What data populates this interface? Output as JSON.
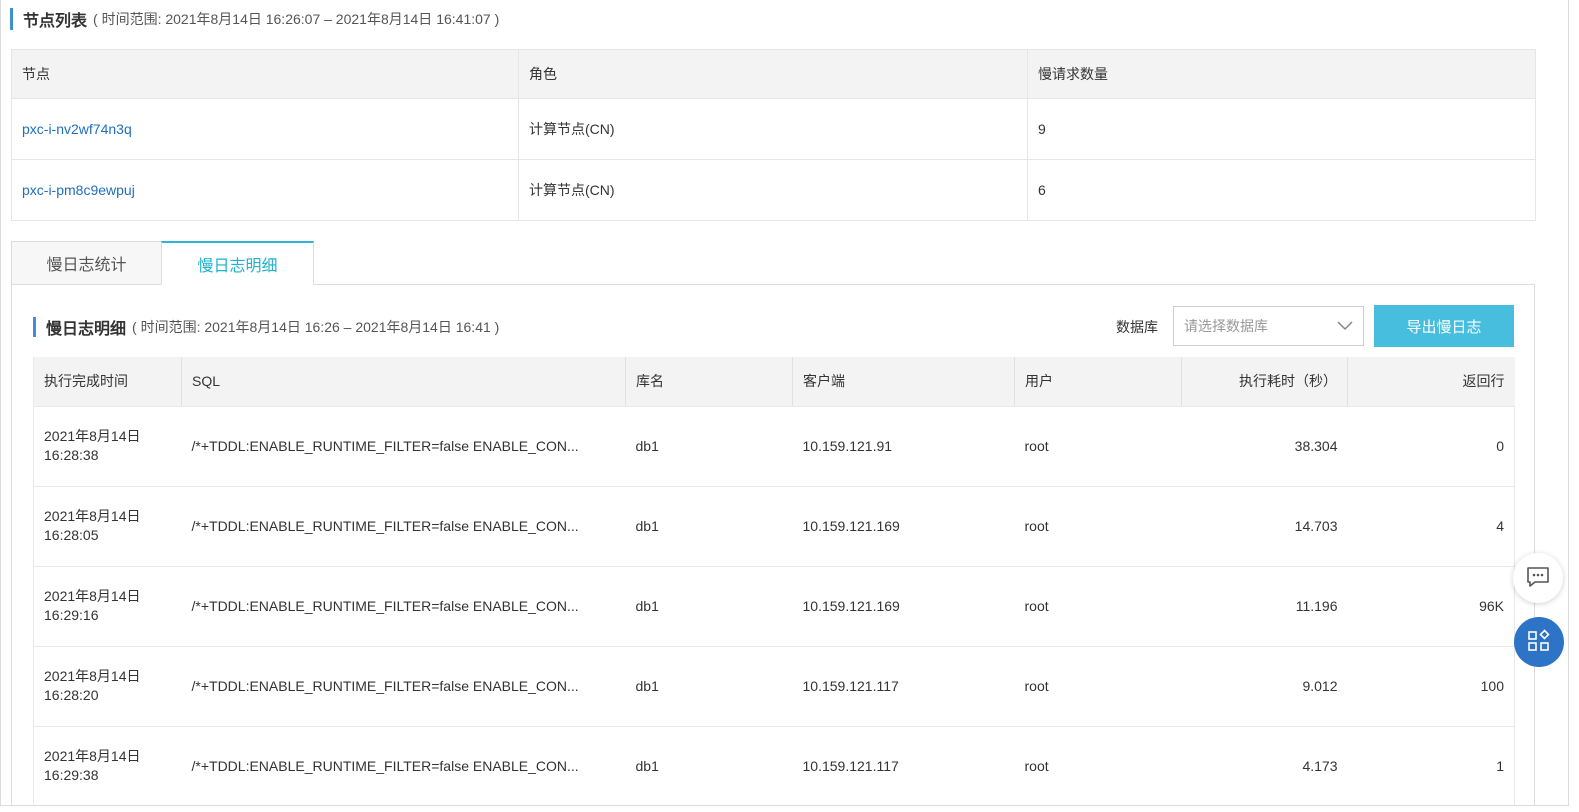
{
  "node_section": {
    "title": "节点列表",
    "range": "( 时间范围: 2021年8月14日 16:26:07 – 2021年8月14日 16:41:07 )",
    "columns": [
      "节点",
      "角色",
      "慢请求数量"
    ],
    "rows": [
      {
        "node": "pxc-i-nv2wf74n3q",
        "role": "计算节点(CN)",
        "count": "9"
      },
      {
        "node": "pxc-i-pm8c9ewpuj",
        "role": "计算节点(CN)",
        "count": "6"
      }
    ]
  },
  "tabs": [
    {
      "label": "慢日志统计",
      "active": false
    },
    {
      "label": "慢日志明细",
      "active": true
    }
  ],
  "detail_section": {
    "title": "慢日志明细",
    "range": "( 时间范围: 2021年8月14日 16:26 – 2021年8月14日 16:41 )",
    "db_label": "数据库",
    "db_placeholder": "请选择数据库",
    "export_label": "导出慢日志",
    "columns": [
      "执行完成时间",
      "SQL",
      "库名",
      "客户端",
      "用户",
      "执行耗时（秒）",
      "返回行"
    ],
    "rows": [
      {
        "date": "2021年8月14日",
        "time": "16:28:38",
        "sql": "/*+TDDL:ENABLE_RUNTIME_FILTER=false ENABLE_CON...",
        "db": "db1",
        "client": "10.159.121.91",
        "user": "root",
        "duration": "38.304",
        "rows": "0"
      },
      {
        "date": "2021年8月14日",
        "time": "16:28:05",
        "sql": "/*+TDDL:ENABLE_RUNTIME_FILTER=false ENABLE_CON...",
        "db": "db1",
        "client": "10.159.121.169",
        "user": "root",
        "duration": "14.703",
        "rows": "4"
      },
      {
        "date": "2021年8月14日",
        "time": "16:29:16",
        "sql": "/*+TDDL:ENABLE_RUNTIME_FILTER=false ENABLE_CON...",
        "db": "db1",
        "client": "10.159.121.169",
        "user": "root",
        "duration": "11.196",
        "rows": "96K"
      },
      {
        "date": "2021年8月14日",
        "time": "16:28:20",
        "sql": "/*+TDDL:ENABLE_RUNTIME_FILTER=false ENABLE_CON...",
        "db": "db1",
        "client": "10.159.121.117",
        "user": "root",
        "duration": "9.012",
        "rows": "100"
      },
      {
        "date": "2021年8月14日",
        "time": "16:29:38",
        "sql": "/*+TDDL:ENABLE_RUNTIME_FILTER=false ENABLE_CON...",
        "db": "db1",
        "client": "10.159.121.117",
        "user": "root",
        "duration": "4.173",
        "rows": "1"
      }
    ]
  },
  "floating": {
    "chat_icon": "chat-bubble-icon",
    "apps_icon": "apps-grid-icon"
  },
  "colors": {
    "accent": "#47bedd",
    "link": "#1f6fbf",
    "title_bar": "#3f8ed6",
    "apps_button": "#2d73c6"
  }
}
